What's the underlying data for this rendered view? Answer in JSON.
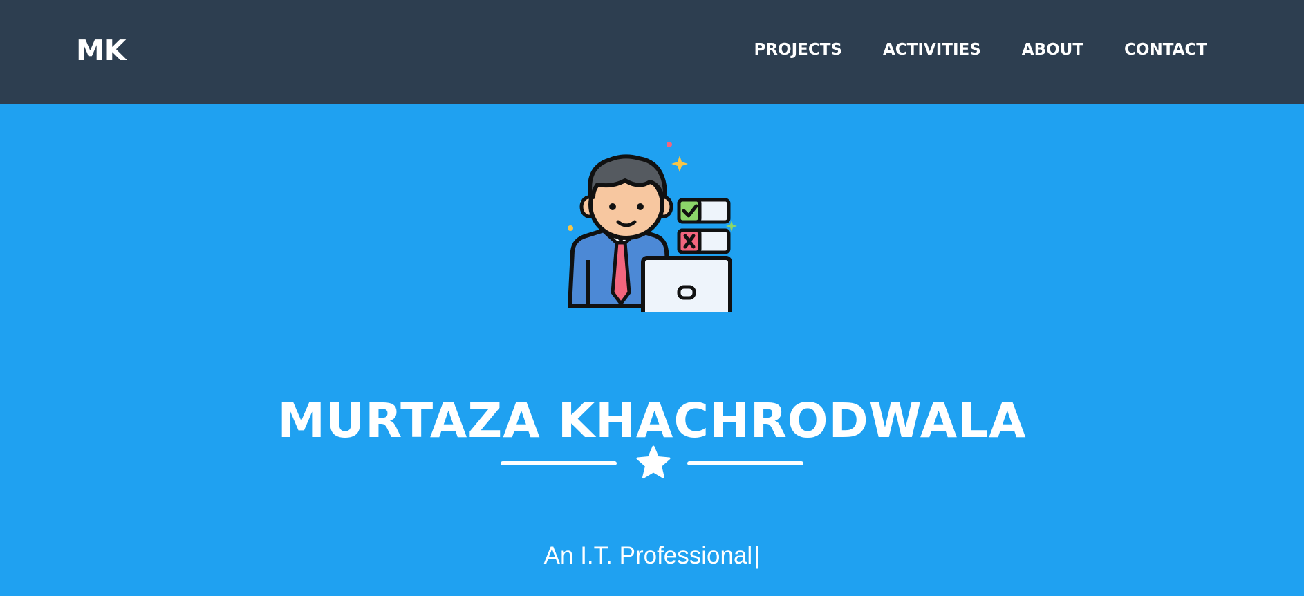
{
  "brand": {
    "label": "MK"
  },
  "nav": {
    "items": [
      {
        "label": "PROJECTS"
      },
      {
        "label": "ACTIVITIES"
      },
      {
        "label": "ABOUT"
      },
      {
        "label": "CONTACT"
      }
    ]
  },
  "hero": {
    "title": "MURTAZA KHACHRODWALA",
    "subtitle": "An I.T. Professional",
    "cursor": "|",
    "avatar_icon": "it-professional-avatar-icon",
    "divider_icon": "star-icon"
  },
  "colors": {
    "navbar_bg": "#2d3e50",
    "hero_bg": "#1fa1f1",
    "text": "#ffffff"
  }
}
